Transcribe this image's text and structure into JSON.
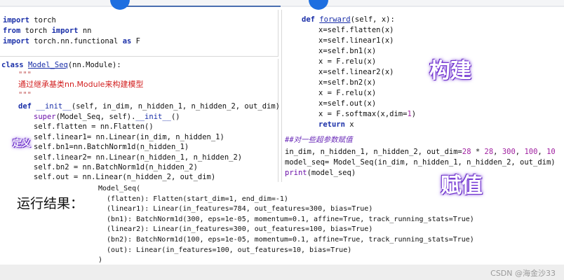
{
  "code_left_top": [
    "import torch",
    "from torch import nn",
    "import torch.nn.functional as F"
  ],
  "code_left_bottom": [
    "class Model_Seq(nn.Module):",
    "\"\"\"",
    "通过继承基类nn.Module来构建模型",
    "\"\"\"",
    "def __init__(self, in_dim, n_hidden_1, n_hidden_2, out_dim):",
    "super(Model_Seq, self).__init__()",
    "self.flatten = nn.Flatten()",
    "self.linear1= nn.Linear(in_dim, n_hidden_1)",
    "self.bn1=nn.BatchNorm1d(n_hidden_1)",
    "self.linear2= nn.Linear(n_hidden_1, n_hidden_2)",
    "self.bn2 = nn.BatchNorm1d(n_hidden_2)",
    "self.out = nn.Linear(n_hidden_2, out_dim)"
  ],
  "code_right": [
    "def forward(self, x):",
    "x=self.flatten(x)",
    "x=self.linear1(x)",
    "x=self.bn1(x)",
    "x = F.relu(x)",
    "x=self.linear2(x)",
    "x=self.bn2(x)",
    "x = F.relu(x)",
    "x=self.out(x)",
    "x = F.softmax(x,dim=1)",
    "return x",
    "##对一些超参数赋值",
    "in_dim, n_hidden_1, n_hidden_2, out_dim=28 * 28, 300, 100, 10",
    "model_seq= Model_Seq(in_dim, n_hidden_1, n_hidden_2, out_dim)",
    "print(model_seq)"
  ],
  "annotations": {
    "define": "定义",
    "build": "构建",
    "assign": "赋值"
  },
  "output_label": "运行结果：",
  "output_lines": [
    "Model_Seq(",
    "  (flatten): Flatten(start_dim=1, end_dim=-1)",
    "  (linear1): Linear(in_features=784, out_features=300, bias=True)",
    "  (bn1): BatchNorm1d(300, eps=1e-05, momentum=0.1, affine=True, track_running_stats=True)",
    "  (linear2): Linear(in_features=300, out_features=100, bias=True)",
    "  (bn2): BatchNorm1d(100, eps=1e-05, momentum=0.1, affine=True, track_running_stats=True)",
    "  (out): Linear(in_features=100, out_features=10, bias=True)",
    ")"
  ],
  "footer": {
    "watermark": "CSDN @海金沙33"
  },
  "colors": {
    "keyword": "#1a2fa8",
    "comment": "#6a2ab8",
    "annotation_glow": "#7a3cd8",
    "progress_dot": "#1e6fe0"
  }
}
